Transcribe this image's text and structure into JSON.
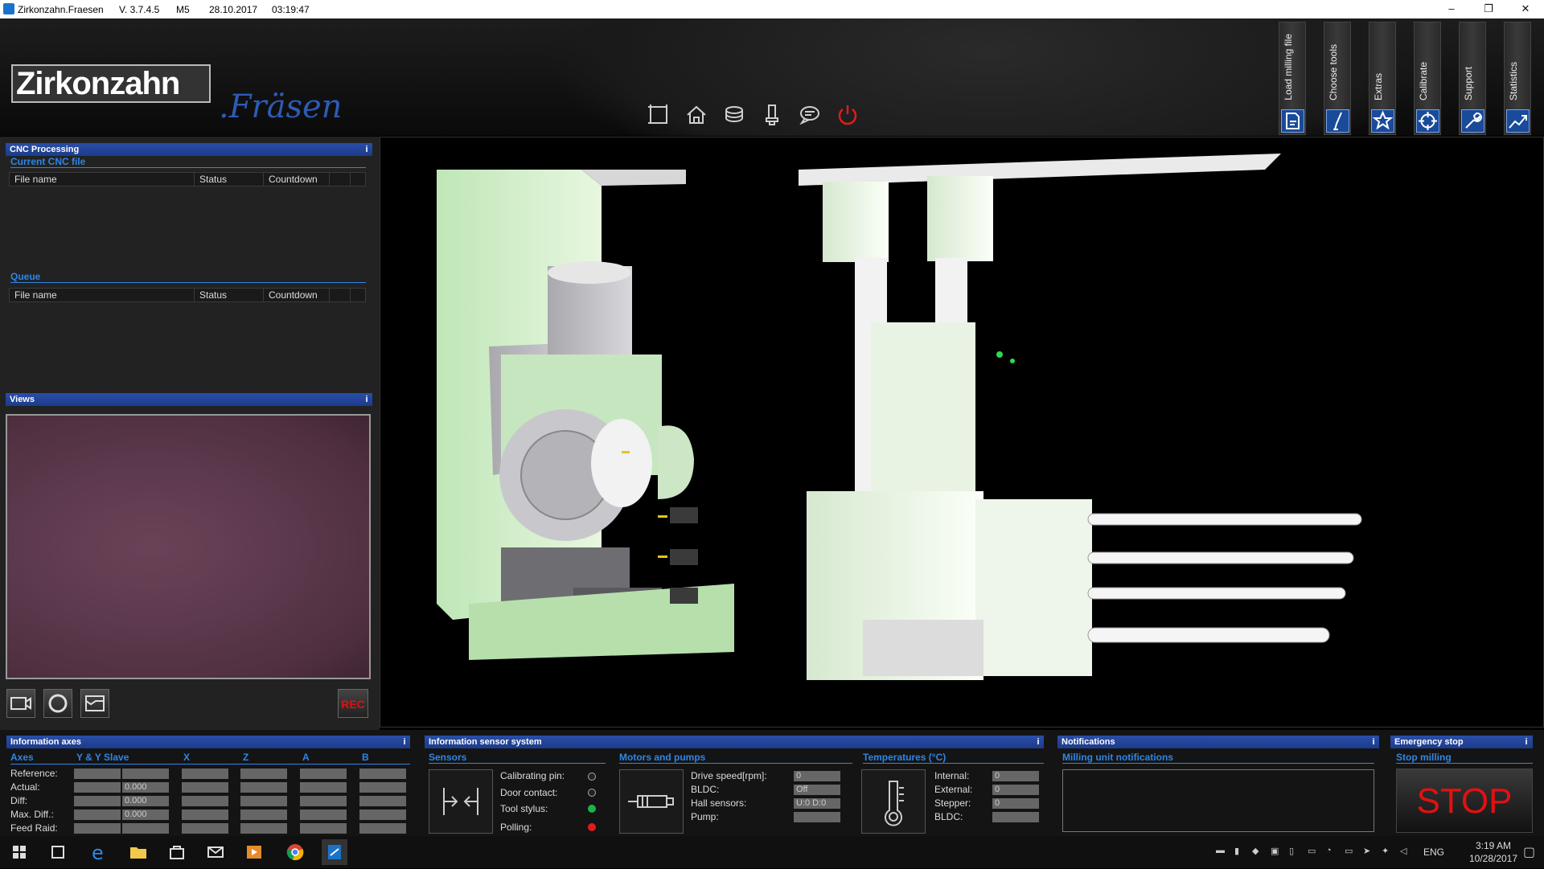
{
  "titlebar": {
    "app": "Zirkonzahn.Fraesen",
    "version": "V. 3.7.4.5",
    "machine": "M5",
    "date": "28.10.2017",
    "time": "03:19:47"
  },
  "logo": {
    "brand": "Zirkonzahn",
    "sub": ".Fräsen"
  },
  "top_tabs": [
    {
      "label": "Load milling file",
      "icon": "document-icon"
    },
    {
      "label": "Choose tools",
      "icon": "tool-icon"
    },
    {
      "label": "Extras",
      "icon": "star-icon"
    },
    {
      "label": "Calibrate",
      "icon": "crosshair-icon"
    },
    {
      "label": "Support",
      "icon": "wrench-icon"
    },
    {
      "label": "Statistics",
      "icon": "chart-icon"
    }
  ],
  "cnc": {
    "title": "CNC Processing",
    "info": "i",
    "current_label": "Current CNC file",
    "queue_label": "Queue",
    "col_file": "File name",
    "col_status": "Status",
    "col_countdown": "Countdown"
  },
  "views": {
    "title": "Views",
    "info": "i",
    "rec": "REC"
  },
  "axes": {
    "title": "Information axes",
    "info": "i",
    "headers": [
      "Axes",
      "Y & Y Slave",
      "X",
      "Z",
      "A",
      "B"
    ],
    "rows": [
      "Reference:",
      "Actual:",
      "Diff:",
      "Max. Diff.:",
      "Feed Raid:"
    ],
    "values": [
      "0.000",
      "0.000",
      "0.000"
    ]
  },
  "sensors": {
    "title": "Information sensor system",
    "info": "i",
    "sensors_label": "Sensors",
    "items": [
      "Calibrating pin:",
      "Door contact:",
      "Tool stylus:",
      "Polling:"
    ],
    "motors_label": "Motors and pumps",
    "motor_items": [
      "Drive speed[rpm]:",
      "BLDC:",
      "Hall sensors:",
      "Pump:"
    ],
    "motor_values": [
      "0",
      "Off",
      "U:0 D:0",
      ""
    ],
    "temps_label": "Temperatures (°C)",
    "temp_items": [
      "Internal:",
      "External:",
      "Stepper:",
      "BLDC:"
    ],
    "temp_values": [
      "0",
      "0",
      "0",
      ""
    ],
    "colors": {
      "off": "#222",
      "green": "#1bb24b",
      "red": "#e01c1c"
    }
  },
  "notifications": {
    "title": "Notifications",
    "info": "i",
    "sub": "Milling unit notifications"
  },
  "emergency": {
    "title": "Emergency stop",
    "info": "i",
    "sub": "Stop milling",
    "button": "STOP"
  },
  "taskbar": {
    "lang": "ENG",
    "time": "3:19 AM",
    "date": "10/28/2017"
  }
}
